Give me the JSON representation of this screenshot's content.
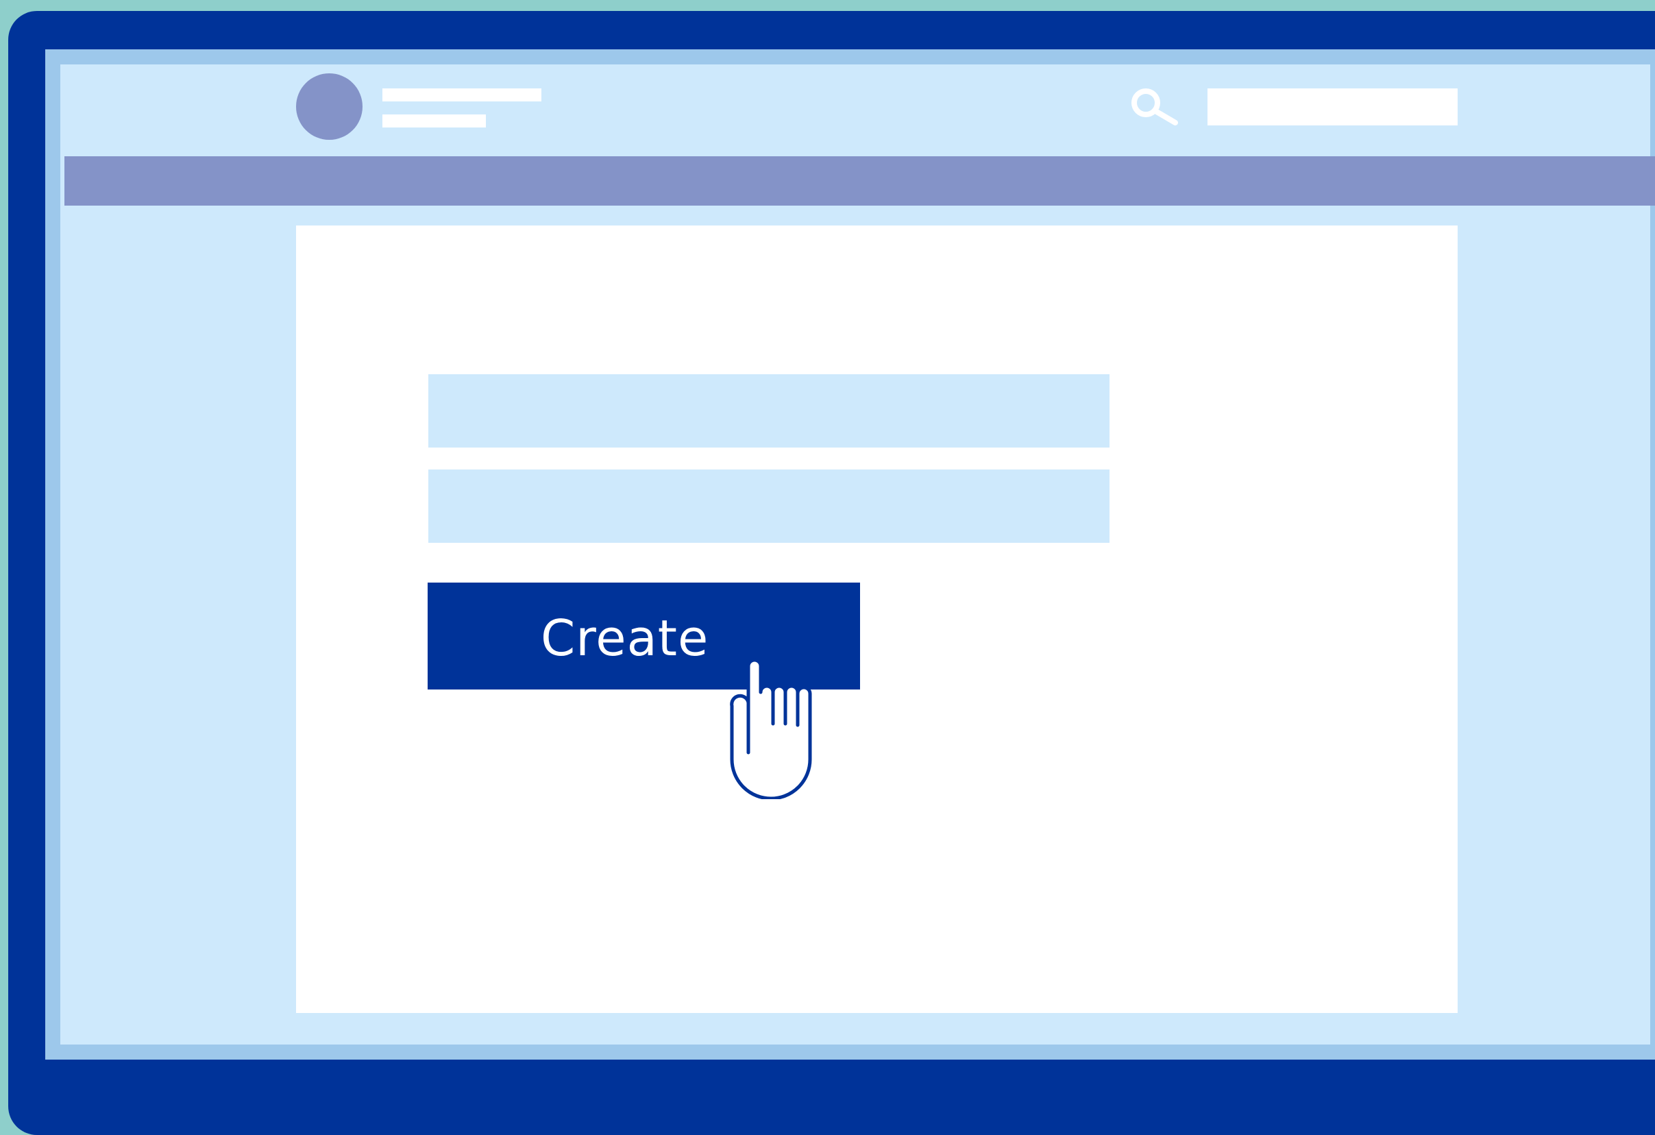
{
  "icons": {
    "avatar": "avatar-circle",
    "search": "search-icon",
    "cursor": "hand-pointer-icon"
  },
  "form": {
    "create_label": "Create"
  },
  "colors": {
    "background": "#8ECFCB",
    "frame": "#003399",
    "screen": "#CEE9FC",
    "nav": "#8493C8",
    "button": "#003399",
    "panel": "#FFFFFF"
  }
}
